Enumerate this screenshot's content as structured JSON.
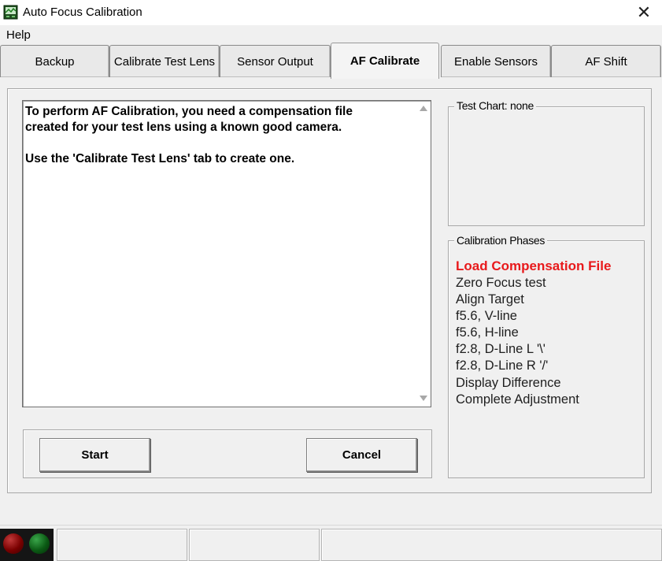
{
  "window": {
    "title": "Auto Focus Calibration",
    "close_symbol": "✕"
  },
  "menu": {
    "items": [
      {
        "label": "Help"
      }
    ]
  },
  "tabs": [
    {
      "label": "Backup",
      "active": false
    },
    {
      "label": "Calibrate Test Lens",
      "active": false
    },
    {
      "label": "Sensor Output",
      "active": false
    },
    {
      "label": "AF Calibrate",
      "active": true
    },
    {
      "label": "Enable Sensors",
      "active": false
    },
    {
      "label": "AF Shift",
      "active": false
    }
  ],
  "message": {
    "text": "To perform AF Calibration, you need a compensation file\ncreated for your test lens using a known good camera.\n\nUse the 'Calibrate Test Lens' tab to create one."
  },
  "buttons": {
    "start": "Start",
    "cancel": "Cancel"
  },
  "test_chart": {
    "legend": "Test Chart: none"
  },
  "calibration_phases": {
    "legend": "Calibration Phases",
    "active_color": "#e8191b",
    "items": [
      {
        "label": "Load Compensation File",
        "active": true
      },
      {
        "label": "Zero Focus test",
        "active": false
      },
      {
        "label": "Align Target",
        "active": false
      },
      {
        "label": "f5.6, V-line",
        "active": false
      },
      {
        "label": "f5.6, H-line",
        "active": false
      },
      {
        "label": "f2.8, D-Line L '\\'",
        "active": false
      },
      {
        "label": "f2.8, D-Line R '/'",
        "active": false
      },
      {
        "label": "Display Difference",
        "active": false
      },
      {
        "label": "Complete Adjustment",
        "active": false
      }
    ]
  },
  "status_bar": {
    "indicators": [
      {
        "name": "red-indicator",
        "color": "#7a0000"
      },
      {
        "name": "green-indicator",
        "color": "#0b5a14"
      }
    ]
  }
}
